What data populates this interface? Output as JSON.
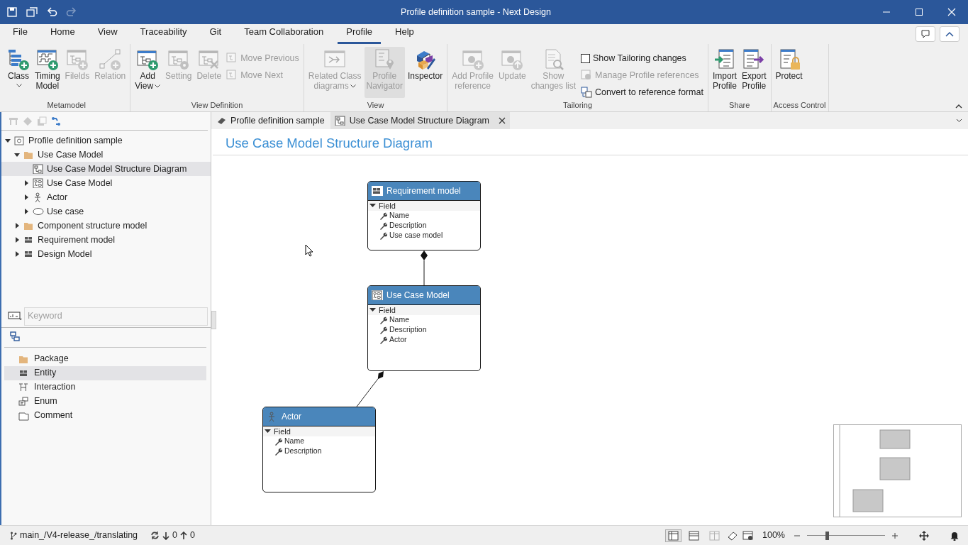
{
  "window": {
    "title": "Profile definition sample - Next Design"
  },
  "quick_access": [
    {
      "disabled": false
    },
    {
      "disabled": false
    },
    {
      "disabled": false
    },
    {
      "disabled": true
    }
  ],
  "menu_tabs": [
    {
      "label": "File",
      "selected": false
    },
    {
      "label": "Home",
      "selected": false
    },
    {
      "label": "View",
      "selected": false
    },
    {
      "label": "Traceability",
      "selected": false
    },
    {
      "label": "Git",
      "selected": false
    },
    {
      "label": "Team Collaboration",
      "selected": false
    },
    {
      "label": "Profile",
      "selected": true
    },
    {
      "label": "Help",
      "selected": false
    }
  ],
  "ribbon_groups": [
    {
      "label": "Metamodel",
      "items": [
        {
          "kind": "large",
          "label": "Class",
          "dropdown": true,
          "disabled": false,
          "pressed": false
        },
        {
          "kind": "large",
          "label": "Timing\nModel",
          "dropdown": false,
          "disabled": false,
          "pressed": false
        },
        {
          "kind": "large",
          "label": "Filelds",
          "dropdown": false,
          "disabled": true,
          "pressed": false
        },
        {
          "kind": "large",
          "label": "Relation",
          "dropdown": false,
          "disabled": true,
          "pressed": false
        }
      ]
    },
    {
      "label": "View Definition",
      "items": [
        {
          "kind": "large",
          "label": "Add\nView",
          "dropdown": true,
          "disabled": false,
          "pressed": false
        },
        {
          "kind": "large",
          "label": "Setting",
          "dropdown": false,
          "disabled": true,
          "pressed": false
        },
        {
          "kind": "large",
          "label": "Delete",
          "dropdown": false,
          "disabled": true,
          "pressed": false
        },
        {
          "kind": "small",
          "label": "Move Previous",
          "disabled": true
        },
        {
          "kind": "small",
          "label": "Move Next",
          "disabled": true
        }
      ]
    },
    {
      "label": "View",
      "items": [
        {
          "kind": "large",
          "label": "Related Class\ndiagrams",
          "dropdown": true,
          "disabled": true,
          "pressed": false
        },
        {
          "kind": "large",
          "label": "Profile\nNavigator",
          "dropdown": false,
          "disabled": true,
          "pressed": true
        },
        {
          "kind": "large",
          "label": "Inspector",
          "dropdown": false,
          "disabled": false,
          "pressed": false
        }
      ]
    },
    {
      "label": "Tailoring",
      "items": [
        {
          "kind": "large",
          "label": "Add Profile\nreference",
          "dropdown": false,
          "disabled": true,
          "pressed": false
        },
        {
          "kind": "large",
          "label": "Update",
          "dropdown": false,
          "disabled": true,
          "pressed": false
        },
        {
          "kind": "large",
          "label": "Show\nchanges list",
          "dropdown": false,
          "disabled": true,
          "pressed": false
        },
        {
          "kind": "checkbox",
          "label": "Show Tailoring changes",
          "checked": false
        },
        {
          "kind": "small",
          "label": "Manage Profile references",
          "disabled": true
        },
        {
          "kind": "small",
          "label": "Convert to reference format",
          "disabled": false
        }
      ]
    },
    {
      "label": "Share",
      "items": [
        {
          "kind": "large",
          "label": "Import\nProfile",
          "dropdown": false,
          "disabled": false,
          "pressed": false
        },
        {
          "kind": "large",
          "label": "Export\nProfile",
          "dropdown": false,
          "disabled": false,
          "pressed": false
        }
      ]
    },
    {
      "label": "Access Control",
      "items": [
        {
          "kind": "large",
          "label": "Protect",
          "dropdown": false,
          "disabled": false,
          "pressed": false
        }
      ]
    }
  ],
  "tree_toolbar": [
    {
      "disabled": true
    },
    {
      "disabled": true
    },
    {
      "disabled": true
    },
    {
      "disabled": false
    }
  ],
  "tree": [
    {
      "label": "Profile definition sample",
      "kind": "profile",
      "expanded": true,
      "selected": false,
      "children": [
        {
          "label": "Use Case Model",
          "kind": "folder",
          "expanded": true,
          "selected": false,
          "children": [
            {
              "label": "Use Case Model Structure Diagram",
              "kind": "diagram",
              "selected": true
            },
            {
              "label": "Use Case Model",
              "kind": "usecase-model",
              "expanded": false,
              "selected": false
            },
            {
              "label": "Actor",
              "kind": "actor",
              "expanded": false,
              "selected": false
            },
            {
              "label": "Use case",
              "kind": "usecase",
              "expanded": false,
              "selected": false
            }
          ]
        },
        {
          "label": "Component structure model",
          "kind": "folder",
          "expanded": false,
          "selected": false
        },
        {
          "label": "Requirement model",
          "kind": "entity",
          "expanded": false,
          "selected": false
        },
        {
          "label": "Design Model",
          "kind": "entity",
          "expanded": false,
          "selected": false
        }
      ]
    }
  ],
  "search": {
    "placeholder": "Keyword"
  },
  "palette": [
    {
      "label": "Package",
      "kind": "folder",
      "selected": false
    },
    {
      "label": "Entity",
      "kind": "entity",
      "selected": true
    },
    {
      "label": "Interaction",
      "kind": "interaction",
      "selected": false
    },
    {
      "label": "Enum",
      "kind": "enum",
      "selected": false
    },
    {
      "label": "Comment",
      "kind": "comment",
      "selected": false
    }
  ],
  "doc_tabs": [
    {
      "label": "Profile definition sample",
      "selected": false,
      "closable": false
    },
    {
      "label": "Use Case Model Structure Diagram",
      "selected": true,
      "closable": true
    }
  ],
  "diagram": {
    "title": "Use Case Model Structure Diagram",
    "nodes": [
      {
        "title": "Requirement model",
        "kind": "entity",
        "section": "Field",
        "fields": [
          "Name",
          "Description",
          "Use case model"
        ]
      },
      {
        "title": "Use Case Model",
        "kind": "usecase-model",
        "section": "Field",
        "fields": [
          "Name",
          "Description",
          "Actor"
        ]
      },
      {
        "title": "Actor",
        "kind": "actor",
        "section": "Field",
        "fields": [
          "Name",
          "Description"
        ]
      }
    ]
  },
  "status_bar": {
    "branch": "main_/V4-release_/translating",
    "incoming": "0",
    "outgoing": "0",
    "layout_buttons": [
      {
        "selected": true,
        "disabled": false
      },
      {
        "selected": false,
        "disabled": false
      },
      {
        "selected": false,
        "disabled": true
      }
    ],
    "zoom": "100%",
    "zoom_slider": {
      "level": 0.25
    }
  }
}
